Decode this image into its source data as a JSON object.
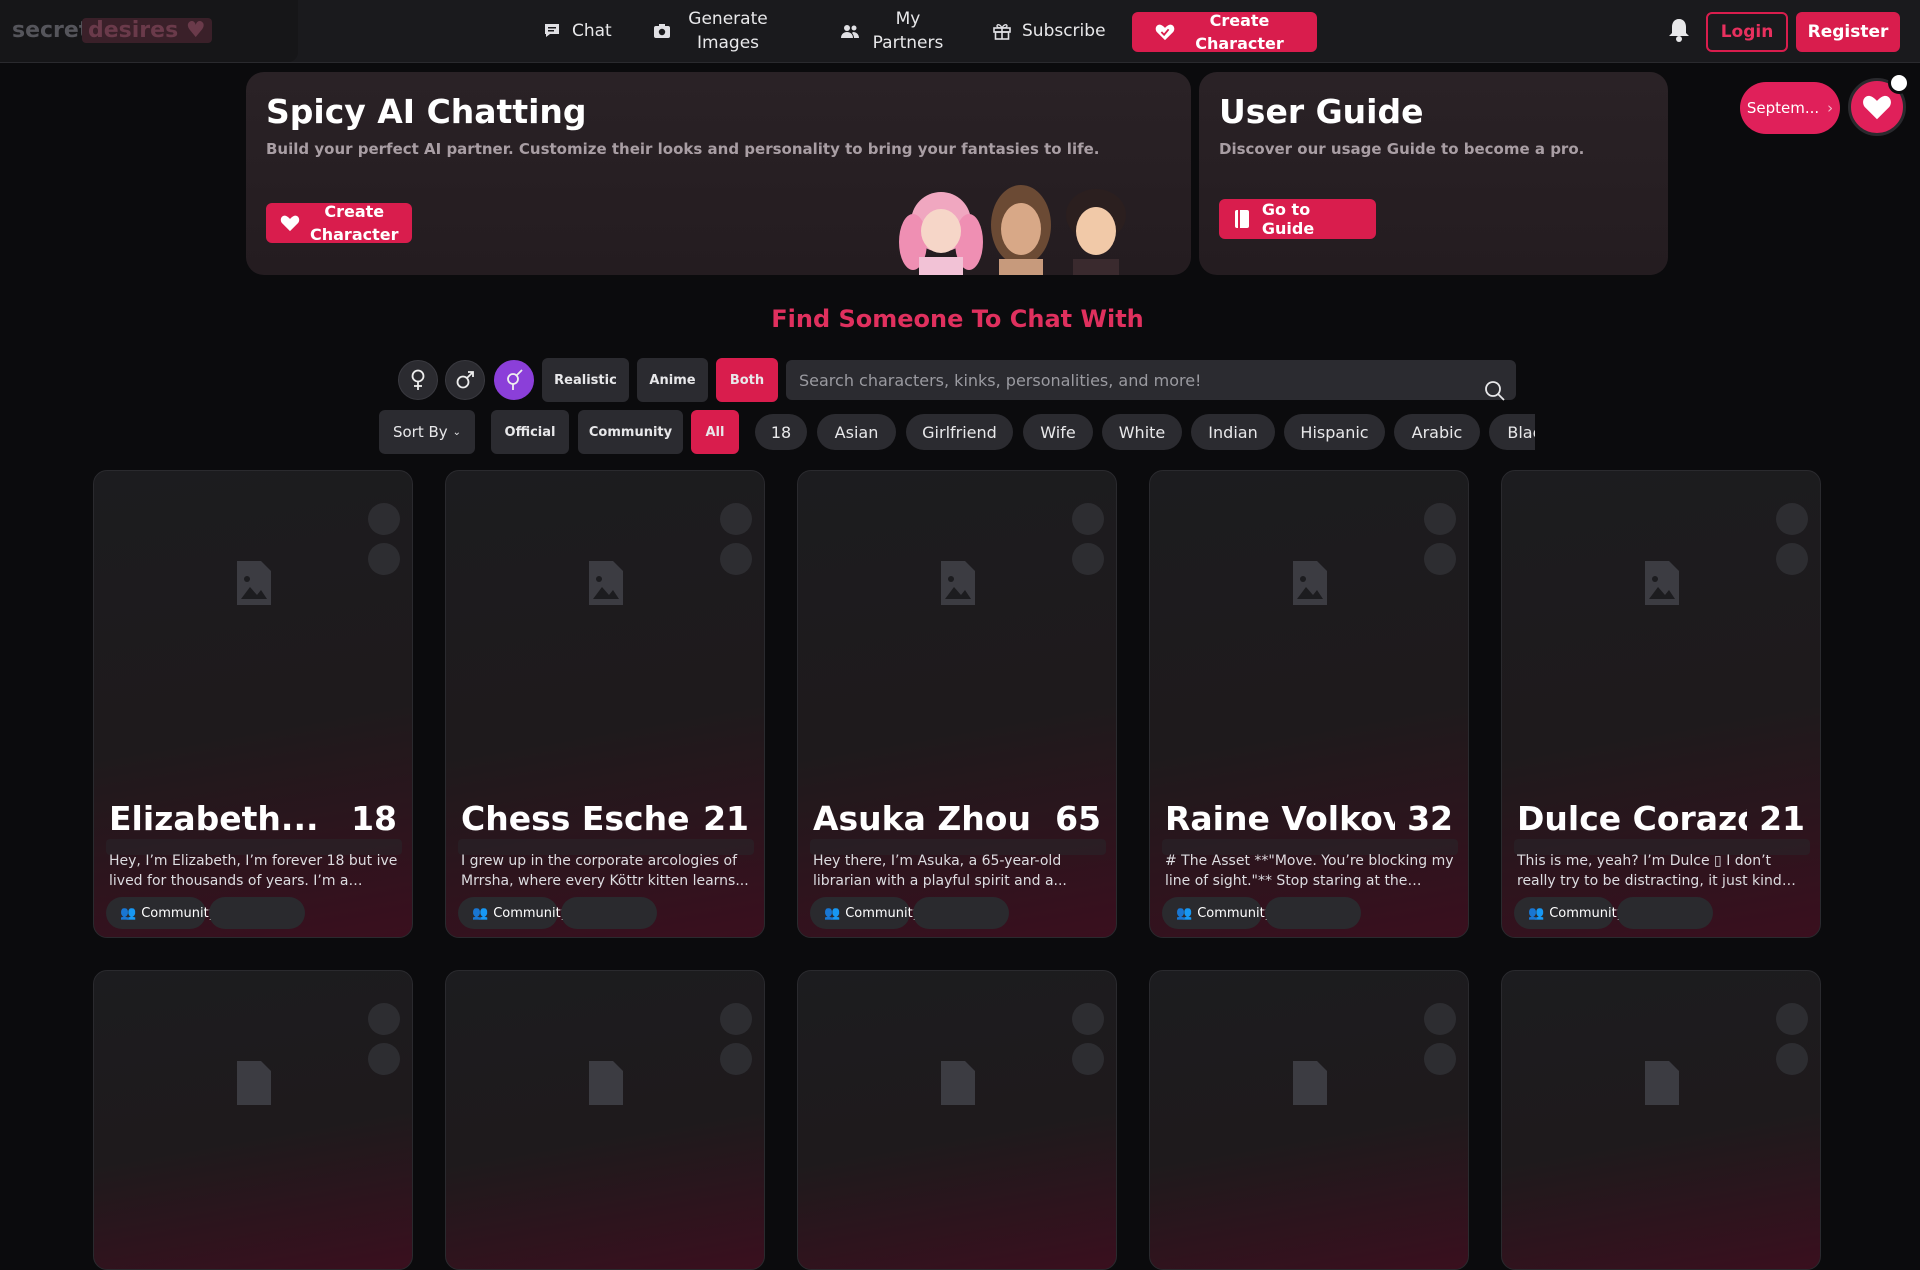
{
  "brand": {
    "part1": "secret",
    "part2": "desires"
  },
  "nav": {
    "chat": "Chat",
    "generate": "Generate Images",
    "partners": "My Partners",
    "subscribe": "Subscribe",
    "create": "Create Character",
    "login": "Login",
    "register": "Register"
  },
  "hero": {
    "title": "Spicy AI Chatting",
    "subtitle": "Build your perfect AI partner. Customize their looks and personality to bring your fantasies to life.",
    "button": "Create Character"
  },
  "guide": {
    "title": "User Guide",
    "subtitle": "Discover our usage Guide to become a pro.",
    "button": "Go to Guide"
  },
  "promo": {
    "label": "Septem...",
    "arrow": "›"
  },
  "find_title": "Find Someone To Chat With",
  "filters": {
    "gender_icons": [
      "female-icon",
      "male-icon",
      "both-genders-icon"
    ],
    "style": [
      "Realistic",
      "Anime",
      "Both"
    ],
    "search_placeholder": "Search characters, kinks, personalities, and more!",
    "sort": "Sort By",
    "source": [
      "Official",
      "Community",
      "All"
    ],
    "tags": [
      "18",
      "Asian",
      "Girlfriend",
      "Wife",
      "White",
      "Indian",
      "Hispanic",
      "Arabic",
      "Black"
    ]
  },
  "cards": [
    {
      "name": "Elizabeth...",
      "age": "18",
      "desc": "Hey, I’m Elizabeth, I’m forever 18 but ive lived for thousands of years. I’m a being...",
      "badge": "Community"
    },
    {
      "name": "Chess Escher ▯",
      "age": "21",
      "desc": "I grew up in the corporate arcologies of Mrrsha, where every Köttr kitten learns...",
      "badge": "Community"
    },
    {
      "name": "Asuka Zhou",
      "age": "65",
      "desc": "Hey there, I’m Asuka, a 65-year-old librarian with a playful spirit and a...",
      "badge": "Community"
    },
    {
      "name": "Raine Volkov",
      "age": "32",
      "desc": "# The Asset **\"Move. You’re blocking my line of sight.\"** Stop staring at the scar....",
      "badge": "Community"
    },
    {
      "name": "Dulce Corazón",
      "age": "21",
      "desc": "This is me, yeah? I’m Dulce ▯ I don’t really try to be distracting, it just kind of...",
      "badge": "Community"
    }
  ],
  "colors": {
    "accent": "#d91d4d",
    "purple": "#8b3fd9",
    "bg": "#0b0b0d"
  }
}
